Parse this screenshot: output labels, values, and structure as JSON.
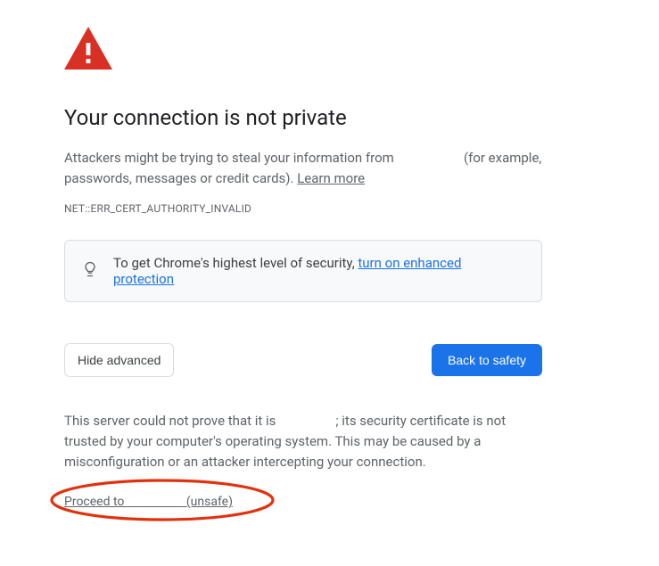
{
  "header": {
    "title": "Your connection is not private"
  },
  "explanation": {
    "prefix": "Attackers might be trying to steal your information from ",
    "suffix": " (for example, passwords, messages or credit cards). ",
    "learn_more": "Learn more"
  },
  "error_code": "NET::ERR_CERT_AUTHORITY_INVALID",
  "suggestion": {
    "text_prefix": "To get Chrome's highest level of security, ",
    "link_text": "turn on enhanced protection"
  },
  "buttons": {
    "hide_advanced": "Hide advanced",
    "back_to_safety": "Back to safety"
  },
  "advanced": {
    "prefix": "This server could not prove that it is ",
    "suffix": "; its security certificate is not trusted by your computer's operating system. This may be caused by a misconfiguration or an attacker intercepting your connection."
  },
  "proceed": {
    "prefix": "Proceed to ",
    "suffix": " (unsafe)"
  },
  "colors": {
    "danger": "#d93025",
    "primary": "#1a73e8",
    "annotation": "#e0320d"
  }
}
